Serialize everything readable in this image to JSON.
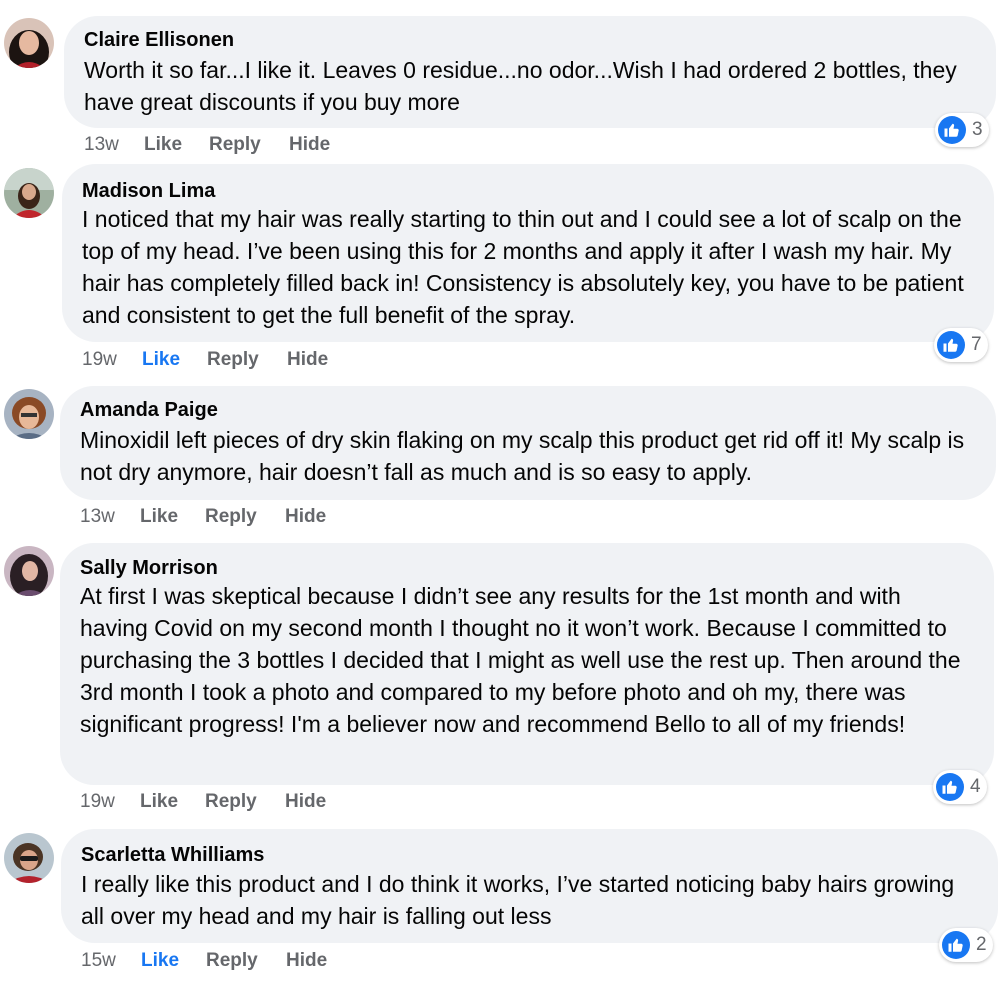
{
  "colors": {
    "bubble": "#f0f2f5",
    "text": "#050505",
    "secondary": "#65676b",
    "accent": "#1877f2"
  },
  "comments": [
    {
      "author": "Claire Ellisonen",
      "text": "Worth it so far...I like it. Leaves 0 residue...no odor...Wish I had ordered 2 bottles, they have great discounts if you buy more",
      "time": "13w",
      "like": "Like",
      "reply": "Reply",
      "hide": "Hide",
      "liked": false,
      "reaction_icon": "like-icon",
      "reaction_count": "3"
    },
    {
      "author": "Madison Lima",
      "text": "I noticed that my hair was really starting to thin out and I could see a lot of scalp on the top of my head. I’ve been using this for 2 months and apply it after I wash my hair. My hair has completely filled back in! Consistency is absolutely key, you have to be patient and consistent to get the full benefit of the spray.",
      "time": "19w",
      "like": "Like",
      "reply": "Reply",
      "hide": "Hide",
      "liked": true,
      "reaction_icon": "like-icon",
      "reaction_count": "7"
    },
    {
      "author": "Amanda Paige",
      "text": "Minoxidil left pieces of dry skin flaking on my scalp this product get rid off it! My scalp is not dry anymore, hair doesn’t fall as much and is so easy to apply.",
      "time": "13w",
      "like": "Like",
      "reply": "Reply",
      "hide": "Hide",
      "liked": false
    },
    {
      "author": "Sally Morrison",
      "text": "At first I was skeptical because I didn’t see any results for the 1st month and with having Covid on my second month I thought no it won’t work. Because I committed to purchasing the 3 bottles I decided that I might as well use the rest up. Then around the 3rd month I took a photo and compared to my before photo and oh my, there was significant progress! I'm a believer now and recommend Bello to all of my friends!",
      "time": "19w",
      "like": "Like",
      "reply": "Reply",
      "hide": "Hide",
      "liked": false,
      "reaction_icon": "like-icon",
      "reaction_count": "4"
    },
    {
      "author": "Scarletta Whilliams",
      "text": "I really like this product and I do think it works, I’ve started noticing baby hairs growing all over my head and my hair is falling out less",
      "time": "15w",
      "like": "Like",
      "reply": "Reply",
      "hide": "Hide",
      "liked": true,
      "reaction_icon": "like-icon",
      "reaction_count": "2"
    }
  ]
}
